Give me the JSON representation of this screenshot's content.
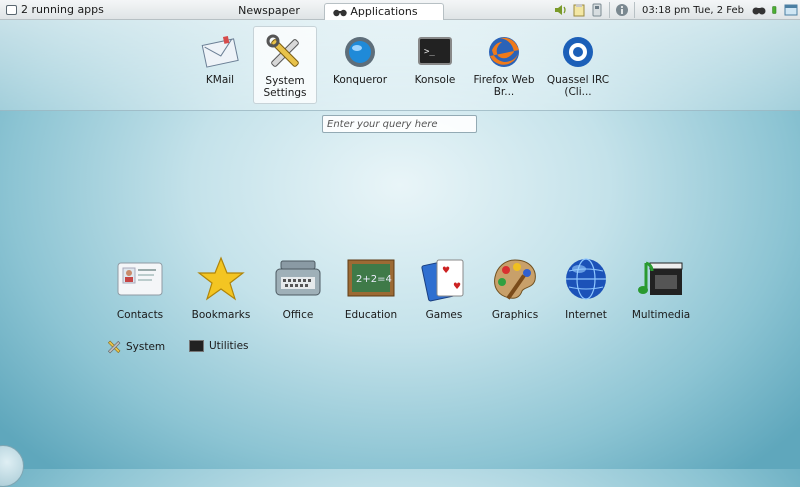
{
  "panel": {
    "running_apps": "2 running apps",
    "tabs": [
      "Newspaper",
      "Applications"
    ],
    "clock": "03:18 pm Tue, 2 Feb"
  },
  "favorites": [
    {
      "label": "KMail",
      "icon": "kmail-icon"
    },
    {
      "label": "System Settings",
      "icon": "system-settings-icon"
    },
    {
      "label": "Konqueror",
      "icon": "konqueror-icon"
    },
    {
      "label": "Konsole",
      "icon": "konsole-icon"
    },
    {
      "label": "Firefox Web Br...",
      "icon": "firefox-icon"
    },
    {
      "label": "Quassel IRC (Cli...",
      "icon": "quassel-icon"
    }
  ],
  "search": {
    "placeholder": "Enter your query here"
  },
  "categories": [
    {
      "label": "Contacts"
    },
    {
      "label": "Bookmarks"
    },
    {
      "label": "Office"
    },
    {
      "label": "Education"
    },
    {
      "label": "Games"
    },
    {
      "label": "Graphics"
    },
    {
      "label": "Internet"
    },
    {
      "label": "Multimedia"
    }
  ],
  "subcategories": [
    {
      "label": "System"
    },
    {
      "label": "Utilities"
    }
  ],
  "icons": {
    "panel_left": "window-icon",
    "tray": [
      "volume-icon",
      "clipboard-icon",
      "usb-icon",
      "info-icon",
      "binoculars-icon",
      "battery-icon",
      "windows-icon"
    ]
  }
}
